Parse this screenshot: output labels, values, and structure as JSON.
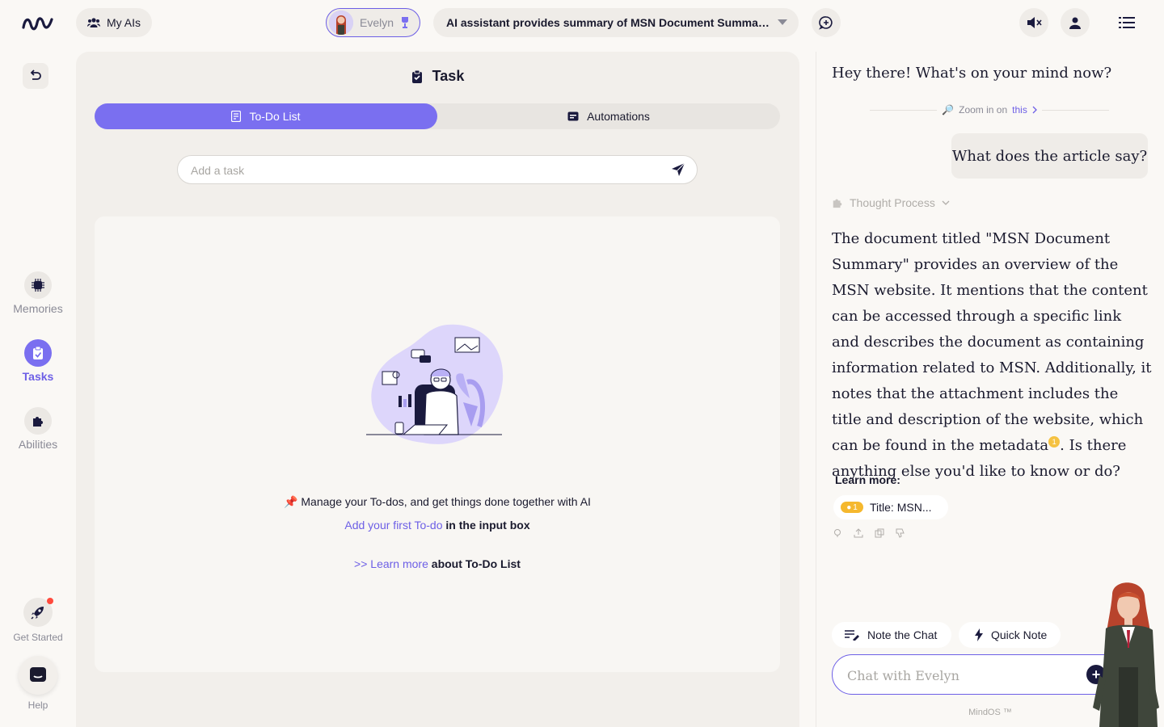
{
  "topbar": {
    "my_ais_label": "My AIs",
    "agent_name": "Evelyn",
    "conversation_title": "AI assistant provides summary of MSN Document Summar..."
  },
  "leftnav": {
    "items": [
      {
        "label": "Memories",
        "icon": "chip-icon"
      },
      {
        "label": "Tasks",
        "icon": "clipboard-icon"
      },
      {
        "label": "Abilities",
        "icon": "puzzle-icon"
      }
    ],
    "get_started": "Get Started",
    "help": "Help"
  },
  "task": {
    "title": "Task",
    "tabs": [
      "To-Do List",
      "Automations"
    ],
    "active_tab": "To-Do List",
    "add_placeholder": "Add a task",
    "empty": {
      "line1": "Manage your To-dos, and get things done together with AI",
      "line2_link": "Add your first To-do",
      "line2_rest": " in the input box",
      "line3_link": ">> Learn more",
      "line3_rest": " about To-Do List"
    }
  },
  "chat": {
    "greeting": "Hey there! What's on your mind now?",
    "zoom_label": "Zoom in on",
    "zoom_link": "this",
    "user_question": "What does the article say?",
    "thought_label": "Thought Process",
    "answer_part1": "The document titled \"MSN Document Summary\" provides an overview of the MSN website. It mentions that the content can be accessed through a specific link and describes the document as containing information related to MSN. Additionally, it notes that the attachment includes the title and description of the website, which can be found in the metadata",
    "citation": "1",
    "answer_part2": ". Is there anything else you'd like to know or do?",
    "learn_more": "Learn more:",
    "source_count": "1",
    "source_label": "Title: MSN...",
    "note_chat": "Note the Chat",
    "quick_note": "Quick Note",
    "input_placeholder": "Chat with Evelyn",
    "brand": "MindOS ™"
  },
  "colors": {
    "accent": "#7a6ff0",
    "background": "#faf8f5",
    "panel": "#f2efeb"
  }
}
